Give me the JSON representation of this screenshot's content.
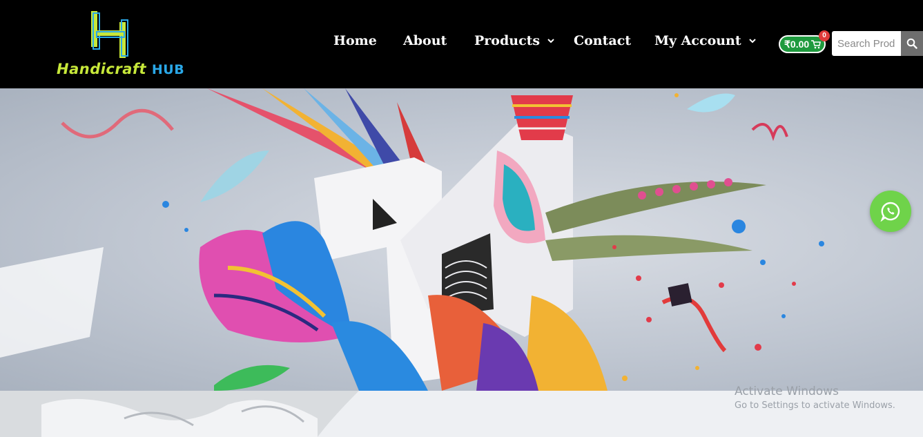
{
  "brand": {
    "logo_word1": "Handicraft",
    "logo_word2": "HUB",
    "colors": {
      "lime": "#c7e83a",
      "blue": "#2aa8e8"
    }
  },
  "nav": {
    "items": [
      {
        "label": "Home",
        "has_dropdown": false
      },
      {
        "label": "About",
        "has_dropdown": false
      },
      {
        "label": "Products",
        "has_dropdown": true
      },
      {
        "label": "Contact",
        "has_dropdown": false
      },
      {
        "label": "My Account",
        "has_dropdown": true
      }
    ]
  },
  "cart": {
    "total": "₹0.00",
    "count": "0",
    "icon": "cart-icon"
  },
  "search": {
    "placeholder": "Search Products",
    "icon": "search-icon"
  },
  "hero": {
    "image": "paper craft collage with colorful feathers and letter shapes"
  },
  "floating": {
    "whatsapp_icon": "whatsapp-icon",
    "color": "#6fd34a"
  },
  "watermark": {
    "title": "Activate Windows",
    "subtitle": "Go to Settings to activate Windows."
  }
}
